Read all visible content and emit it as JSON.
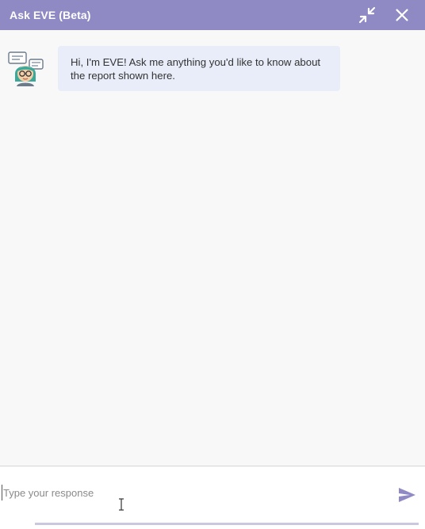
{
  "header": {
    "title": "Ask EVE (Beta)",
    "minimize_icon": "collapse-arrows-icon",
    "close_icon": "close-icon",
    "background_color": "#8f89c4"
  },
  "conversation": {
    "messages": [
      {
        "sender_icon": "eve-avatar-icon",
        "text": "Hi, I'm EVE! Ask me anything you'd like to know about the report shown here."
      }
    ],
    "bubble_color": "#e8edf9"
  },
  "composer": {
    "placeholder": "Type your response",
    "value": "",
    "send_icon": "send-icon",
    "send_color": "#8f89c4"
  }
}
